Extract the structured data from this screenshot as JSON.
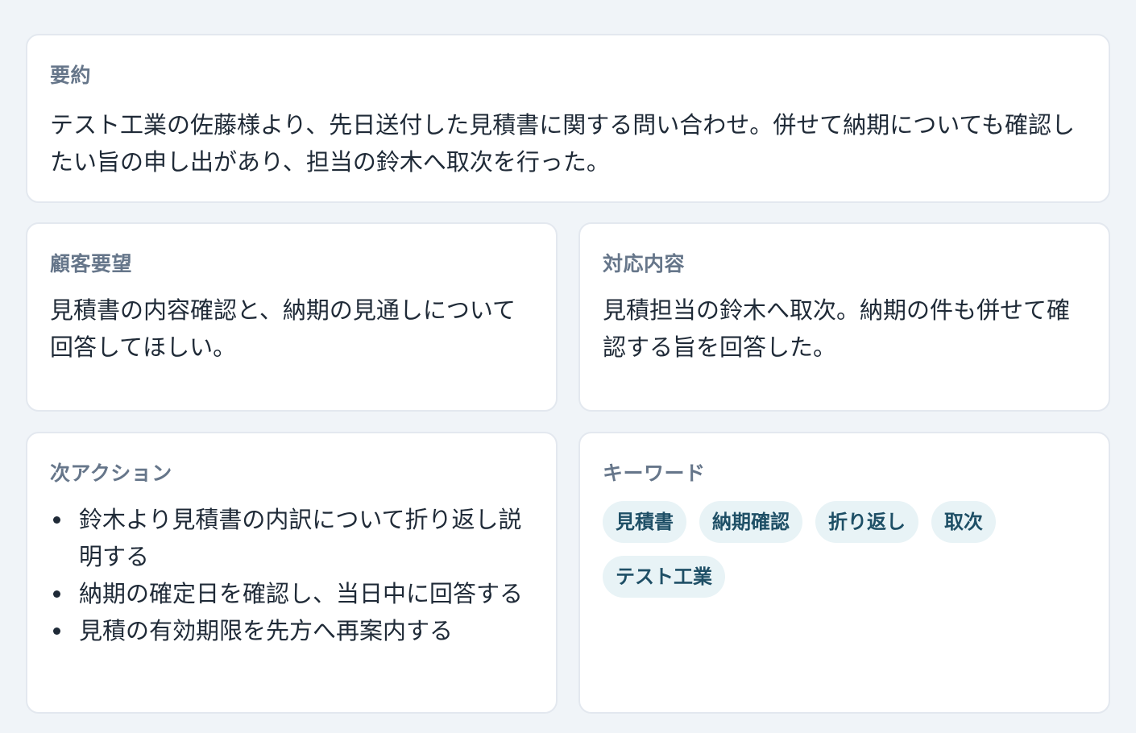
{
  "summary": {
    "title": "要約",
    "text": "テスト工業の佐藤様より、先日送付した見積書に関する問い合わせ。併せて納期についても確認したい旨の申し出があり、担当の鈴木へ取次を行った。"
  },
  "customer_request": {
    "title": "顧客要望",
    "text": "見積書の内容確認と、納期の見通しについて回答してほしい。"
  },
  "response": {
    "title": "対応内容",
    "text": "見積担当の鈴木へ取次。納期の件も併せて確認する旨を回答した。"
  },
  "next_actions": {
    "title": "次アクション",
    "items": [
      "鈴木より見積書の内訳について折り返し説明する",
      "納期の確定日を確認し、当日中に回答する",
      "見積の有効期限を先方へ再案内する"
    ]
  },
  "keywords": {
    "title": "キーワード",
    "items": [
      "見積書",
      "納期確認",
      "折り返し",
      "取次",
      "テスト工業"
    ]
  },
  "colors": {
    "background": "#f0f4f8",
    "card": "#ffffff",
    "title": "#66768a",
    "chip_bg": "#e8f3f6",
    "chip_text": "#1e4f66"
  }
}
